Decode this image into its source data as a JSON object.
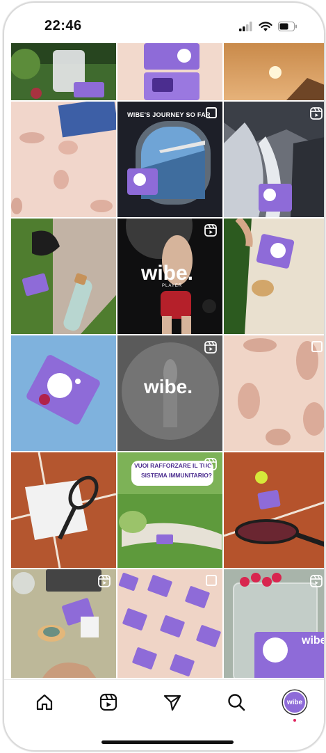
{
  "status_bar": {
    "time": "22:46"
  },
  "brand": {
    "name": "wibe",
    "accent": "#8e6bd8",
    "dark_purple": "#4b2d8f"
  },
  "posts": [
    {
      "scene": "garden-jug"
    },
    {
      "scene": "product-box-top"
    },
    {
      "scene": "sunset"
    },
    {
      "scene": "pills-pink"
    },
    {
      "scene": "airplane-window",
      "caption": "WIBE'S JOURNEY SO FAR",
      "badge": "multi"
    },
    {
      "scene": "waterfall-rocks",
      "badge": "reel"
    },
    {
      "scene": "grass-headphones-bottle"
    },
    {
      "scene": "boxer-wibe",
      "logo_text": "wibe.",
      "sub_text": "PLAYER",
      "badge": "reel"
    },
    {
      "scene": "hand-box-bag"
    },
    {
      "scene": "sky-box"
    },
    {
      "scene": "wibe-gray",
      "logo_text": "wibe.",
      "badge": "reel"
    },
    {
      "scene": "pills-tan",
      "badge": "multi"
    },
    {
      "scene": "tennis-shirt"
    },
    {
      "scene": "picnic-grass",
      "caption_line1": "VUOI RAFFORZARE IL TUO",
      "caption_line2": "SISTEMA IMMUNITARIO?",
      "badge": "reel"
    },
    {
      "scene": "tennis-ball-racket"
    },
    {
      "scene": "table-laptop-tea",
      "badge": "reel"
    },
    {
      "scene": "boxes-pattern",
      "badge": "multi"
    },
    {
      "scene": "glass-raspberries",
      "logo_text": "wibe",
      "badge": "reel"
    }
  ],
  "tab_bar": {
    "items": [
      {
        "icon": "home-icon"
      },
      {
        "icon": "reels-icon"
      },
      {
        "icon": "send-icon"
      },
      {
        "icon": "search-icon"
      },
      {
        "icon": "profile-avatar",
        "label": "wibe"
      }
    ]
  }
}
